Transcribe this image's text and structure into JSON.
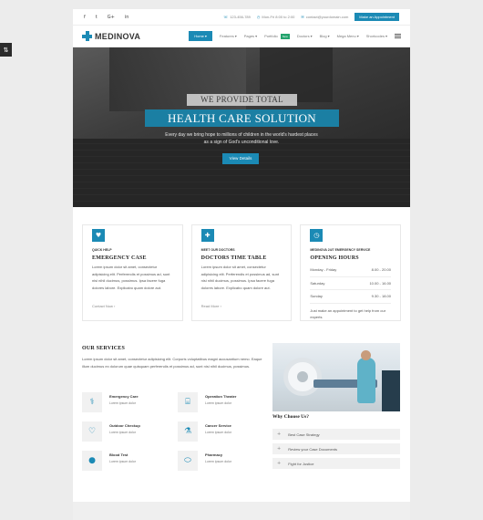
{
  "topbar": {
    "social": [
      "f",
      "t",
      "G+",
      "in"
    ],
    "contacts": [
      {
        "icon": "phone-icon",
        "text": "123-456-789"
      },
      {
        "icon": "clock-icon",
        "text": "Mon-Fri 8:00 to 2:00"
      },
      {
        "icon": "mail-icon",
        "text": "contact@yourdomain.com"
      }
    ],
    "appointment": "Make an Appointment"
  },
  "brand": {
    "name": "MEDINOVA"
  },
  "menu": {
    "items": [
      "Home",
      "Features",
      "Pages",
      "Portfolio",
      "Doctors",
      "Blog",
      "Mega Menu",
      "Shortcodes"
    ],
    "new_badge": "New"
  },
  "hero": {
    "subtitle": "WE PROVIDE TOTAL",
    "title": "HEALTH CARE SOLUTION",
    "description": "Every day we bring hope to millions of children in the world's hardest places as a sign of God's unconditional love.",
    "button": "View Details"
  },
  "cards": [
    {
      "tag": "QUICK HELP",
      "title": "EMERGENCY CASE",
      "text": "Lorem ipsum dolor sit amet, consectetur adipisicing elit. Perferendis et possimus ad, sunt nisi nihil ducimus, possimus. Ipsa facere fuga dolores labore. Explicabo quam dolore aut.",
      "link": "Contact Now"
    },
    {
      "tag": "MEET OUR DOCTORS",
      "title": "DOCTORS TIME TABLE",
      "text": "Lorem ipsum dolor sit amet, consectetur adipisicing elit. Perferendis et possimus ad, sunt nisi nihil ducimus, possimus. Ipsa facere fuga dolores labore. Explicabo quam dolore aut.",
      "link": "Read More"
    },
    {
      "tag": "MEDINOVA 24/7 EMERGENCY SERVICE",
      "title": "OPENING HOURS",
      "hours": [
        {
          "day": "Monday - Friday",
          "time": "8.00 - 20.00"
        },
        {
          "day": "Saturday",
          "time": "10.00 - 16.00"
        },
        {
          "day": "Sunday",
          "time": "9.30 - 18.00"
        }
      ],
      "note": "Just make an appointment to get help from our experts"
    }
  ],
  "services": {
    "heading": "OUR SERVICES",
    "text": "Lorem ipsum dolor sit amet, consectetur adipisicing elit. Corporis voluptatibus magni accusantium nemo. Eaque illum ducimus ex dolorum quae quisquam perferendis et possimus ad, sunt nisi nihil ducimus, possimus.",
    "items": [
      {
        "name": "Emergency Care",
        "desc": "Lorem ipsum dolor",
        "icon": "stethoscope-icon",
        "glyph": "⚕"
      },
      {
        "name": "Operation Theater",
        "desc": "Lorem ipsum dolor",
        "icon": "bed-icon",
        "glyph": "⌸"
      },
      {
        "name": "Outdoor Checkup",
        "desc": "Lorem ipsum dolor",
        "icon": "checkup-icon",
        "glyph": "♡"
      },
      {
        "name": "Cancer Service",
        "desc": "Lorem ipsum dolor",
        "icon": "microscope-icon",
        "glyph": "⚗"
      },
      {
        "name": "Blood Test",
        "desc": "Lorem ipsum dolor",
        "icon": "blood-drop-icon",
        "glyph": "●"
      },
      {
        "name": "Pharmacy",
        "desc": "Lorem ipsum dolor",
        "icon": "pill-icon",
        "glyph": "⬭"
      }
    ]
  },
  "why": {
    "heading": "Why Choose Us?",
    "items": [
      "Best Case Strategy",
      "Review your Case Documents",
      "Fight for Justice"
    ]
  }
}
